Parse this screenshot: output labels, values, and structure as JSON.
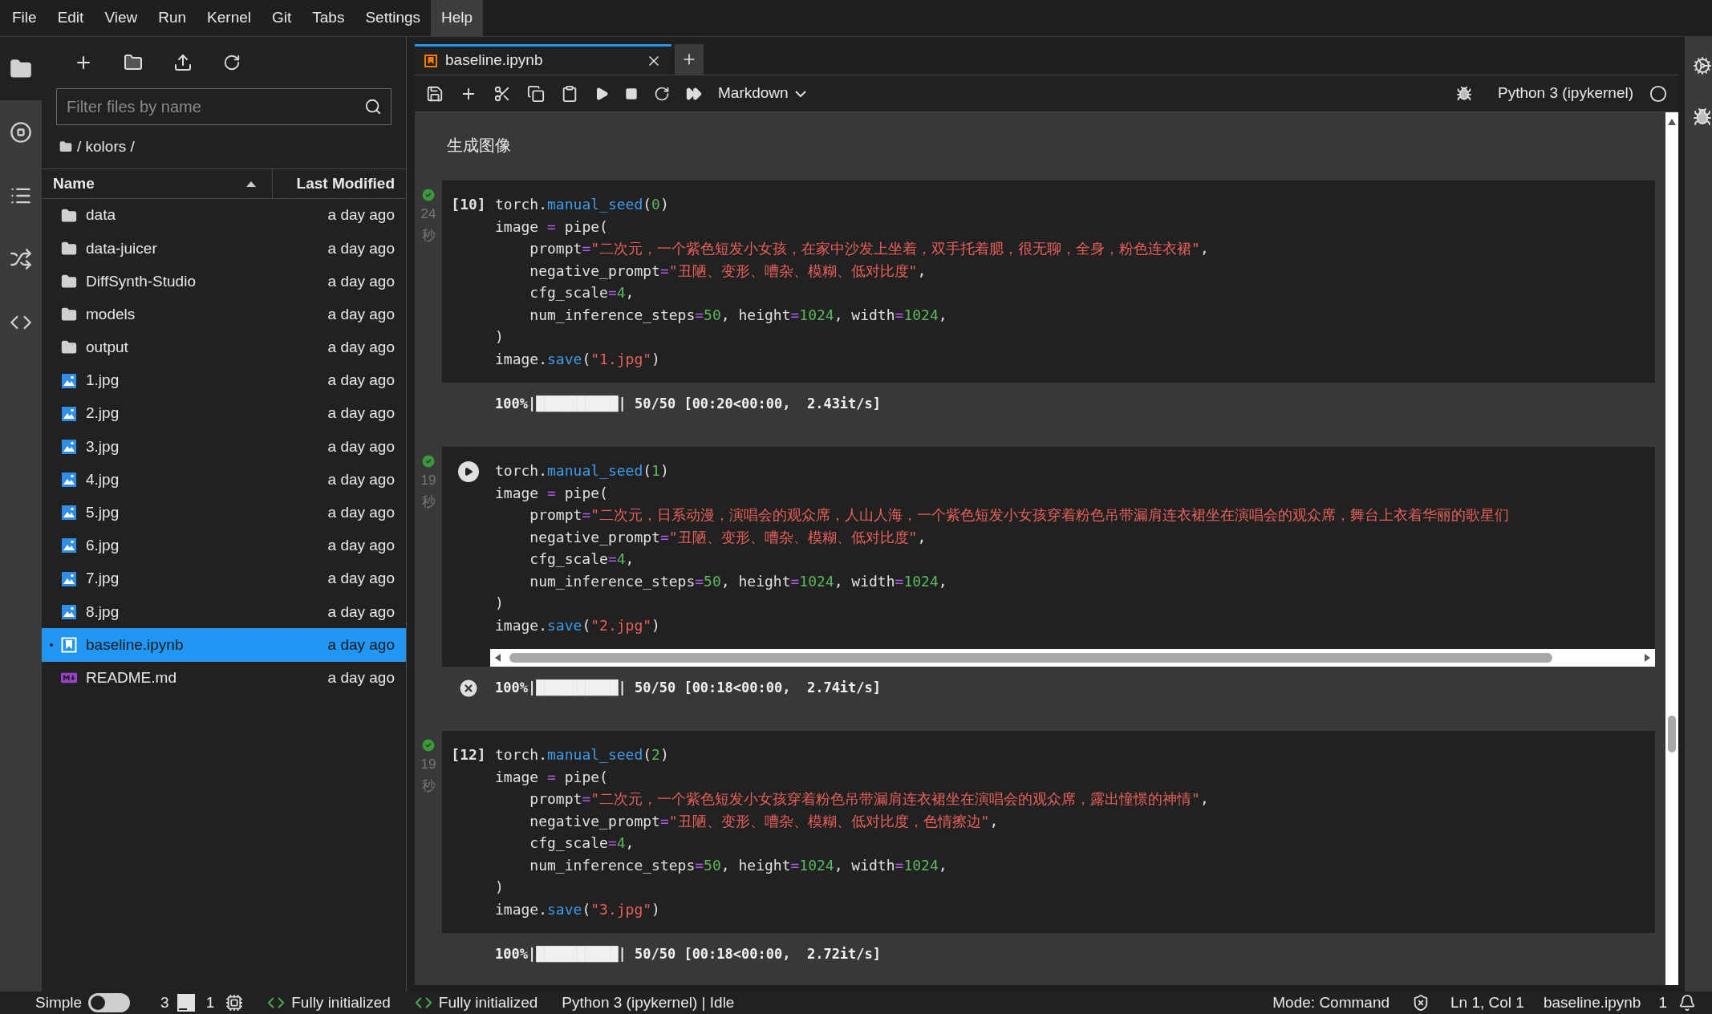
{
  "menu": [
    {
      "label": "File",
      "selected": false
    },
    {
      "label": "Edit",
      "selected": false
    },
    {
      "label": "View",
      "selected": false
    },
    {
      "label": "Run",
      "selected": false
    },
    {
      "label": "Kernel",
      "selected": false
    },
    {
      "label": "Git",
      "selected": false
    },
    {
      "label": "Tabs",
      "selected": false
    },
    {
      "label": "Settings",
      "selected": false
    },
    {
      "label": "Help",
      "selected": true
    }
  ],
  "activity_bar": [
    {
      "kind": "files",
      "selected": true
    },
    {
      "kind": "running",
      "selected": false
    },
    {
      "kind": "toc",
      "selected": false
    },
    {
      "kind": "git",
      "selected": false
    },
    {
      "kind": "code",
      "selected": false
    }
  ],
  "file_browser": {
    "filter": {
      "placeholder": "Filter files by name"
    },
    "path": "/ kolors /",
    "columns": [
      "Name",
      "Last Modified"
    ],
    "items": [
      {
        "name": "data",
        "modified": "a day ago",
        "kind": "folder",
        "selected": false
      },
      {
        "name": "data-juicer",
        "modified": "a day ago",
        "kind": "folder",
        "selected": false
      },
      {
        "name": "DiffSynth-Studio",
        "modified": "a day ago",
        "kind": "folder",
        "selected": false
      },
      {
        "name": "models",
        "modified": "a day ago",
        "kind": "folder",
        "selected": false
      },
      {
        "name": "output",
        "modified": "a day ago",
        "kind": "folder",
        "selected": false
      },
      {
        "name": "1.jpg",
        "modified": "a day ago",
        "kind": "image",
        "selected": false
      },
      {
        "name": "2.jpg",
        "modified": "a day ago",
        "kind": "image",
        "selected": false
      },
      {
        "name": "3.jpg",
        "modified": "a day ago",
        "kind": "image",
        "selected": false
      },
      {
        "name": "4.jpg",
        "modified": "a day ago",
        "kind": "image",
        "selected": false
      },
      {
        "name": "5.jpg",
        "modified": "a day ago",
        "kind": "image",
        "selected": false
      },
      {
        "name": "6.jpg",
        "modified": "a day ago",
        "kind": "image",
        "selected": false
      },
      {
        "name": "7.jpg",
        "modified": "a day ago",
        "kind": "image",
        "selected": false
      },
      {
        "name": "8.jpg",
        "modified": "a day ago",
        "kind": "image",
        "selected": false
      },
      {
        "name": "baseline.ipynb",
        "modified": "a day ago",
        "kind": "notebook",
        "selected": true
      },
      {
        "name": "README.md",
        "modified": "a day ago",
        "kind": "markdown",
        "selected": false
      }
    ]
  },
  "tab": {
    "title": "baseline.ipynb"
  },
  "toolbar": {
    "cell_type": "Markdown",
    "kernel": "Python 3 (ipykernel)"
  },
  "markdown_cell": {
    "text": "生成图像"
  },
  "cells": [
    {
      "prompt": "[10]",
      "succeeded": true,
      "time_value": "24",
      "time_unit": "秒",
      "h_scrollbar": false,
      "lines": [
        [
          {
            "kind": "plain",
            "text": "torch."
          },
          {
            "kind": "func",
            "text": "manual_seed"
          },
          {
            "kind": "plain",
            "text": "("
          },
          {
            "kind": "num",
            "text": "0"
          },
          {
            "kind": "plain",
            "text": ")"
          }
        ],
        [
          {
            "kind": "plain",
            "text": "image "
          },
          {
            "kind": "op",
            "text": "="
          },
          {
            "kind": "plain",
            "text": " pipe("
          }
        ],
        [
          {
            "kind": "plain",
            "text": "    prompt"
          },
          {
            "kind": "op",
            "text": "="
          },
          {
            "kind": "str",
            "text": "\"二次元，一个紫色短发小女孩，在家中沙发上坐着，双手托着腮，很无聊，全身，粉色连衣裙\""
          },
          {
            "kind": "plain",
            "text": ","
          }
        ],
        [
          {
            "kind": "plain",
            "text": "    negative_prompt"
          },
          {
            "kind": "op",
            "text": "="
          },
          {
            "kind": "str",
            "text": "\"丑陋、变形、嘈杂、模糊、低对比度\""
          },
          {
            "kind": "plain",
            "text": ","
          }
        ],
        [
          {
            "kind": "plain",
            "text": "    cfg_scale"
          },
          {
            "kind": "op",
            "text": "="
          },
          {
            "kind": "num",
            "text": "4"
          },
          {
            "kind": "plain",
            "text": ","
          }
        ],
        [
          {
            "kind": "plain",
            "text": "    num_inference_steps"
          },
          {
            "kind": "op",
            "text": "="
          },
          {
            "kind": "num",
            "text": "50"
          },
          {
            "kind": "plain",
            "text": ", height"
          },
          {
            "kind": "op",
            "text": "="
          },
          {
            "kind": "num",
            "text": "1024"
          },
          {
            "kind": "plain",
            "text": ", width"
          },
          {
            "kind": "op",
            "text": "="
          },
          {
            "kind": "num",
            "text": "1024"
          },
          {
            "kind": "plain",
            "text": ","
          }
        ],
        [
          {
            "kind": "plain",
            "text": ")"
          }
        ],
        [
          {
            "kind": "plain",
            "text": "image."
          },
          {
            "kind": "func",
            "text": "save"
          },
          {
            "kind": "plain",
            "text": "("
          },
          {
            "kind": "str",
            "text": "\"1.jpg\""
          },
          {
            "kind": "plain",
            "text": ")"
          }
        ]
      ],
      "output": {
        "text": "100%|██████████| 50/50 [00:20<00:00,  2.43it/s]",
        "clear_icon": false
      }
    },
    {
      "succeeded": true,
      "time_value": "19",
      "time_unit": "秒",
      "h_scrollbar": true,
      "lines": [
        [
          {
            "kind": "plain",
            "text": "torch."
          },
          {
            "kind": "func",
            "text": "manual_seed"
          },
          {
            "kind": "plain",
            "text": "("
          },
          {
            "kind": "num",
            "text": "1"
          },
          {
            "kind": "plain",
            "text": ")"
          }
        ],
        [
          {
            "kind": "plain",
            "text": "image "
          },
          {
            "kind": "op",
            "text": "="
          },
          {
            "kind": "plain",
            "text": " pipe("
          }
        ],
        [
          {
            "kind": "plain",
            "text": "    prompt"
          },
          {
            "kind": "op",
            "text": "="
          },
          {
            "kind": "str",
            "text": "\"二次元，日系动漫，演唱会的观众席，人山人海，一个紫色短发小女孩穿着粉色吊带漏肩连衣裙坐在演唱会的观众席，舞台上衣着华丽的歌星们"
          }
        ],
        [
          {
            "kind": "plain",
            "text": "    negative_prompt"
          },
          {
            "kind": "op",
            "text": "="
          },
          {
            "kind": "str",
            "text": "\"丑陋、变形、嘈杂、模糊、低对比度\""
          },
          {
            "kind": "plain",
            "text": ","
          }
        ],
        [
          {
            "kind": "plain",
            "text": "    cfg_scale"
          },
          {
            "kind": "op",
            "text": "="
          },
          {
            "kind": "num",
            "text": "4"
          },
          {
            "kind": "plain",
            "text": ","
          }
        ],
        [
          {
            "kind": "plain",
            "text": "    num_inference_steps"
          },
          {
            "kind": "op",
            "text": "="
          },
          {
            "kind": "num",
            "text": "50"
          },
          {
            "kind": "plain",
            "text": ", height"
          },
          {
            "kind": "op",
            "text": "="
          },
          {
            "kind": "num",
            "text": "1024"
          },
          {
            "kind": "plain",
            "text": ", width"
          },
          {
            "kind": "op",
            "text": "="
          },
          {
            "kind": "num",
            "text": "1024"
          },
          {
            "kind": "plain",
            "text": ","
          }
        ],
        [
          {
            "kind": "plain",
            "text": ")"
          }
        ],
        [
          {
            "kind": "plain",
            "text": "image."
          },
          {
            "kind": "func",
            "text": "save"
          },
          {
            "kind": "plain",
            "text": "("
          },
          {
            "kind": "str",
            "text": "\"2.jpg\""
          },
          {
            "kind": "plain",
            "text": ")"
          }
        ]
      ],
      "output": {
        "text": "100%|██████████| 50/50 [00:18<00:00,  2.74it/s]",
        "clear_icon": true
      }
    },
    {
      "prompt": "[12]",
      "succeeded": true,
      "time_value": "19",
      "time_unit": "秒",
      "h_scrollbar": false,
      "lines": [
        [
          {
            "kind": "plain",
            "text": "torch."
          },
          {
            "kind": "func",
            "text": "manual_seed"
          },
          {
            "kind": "plain",
            "text": "("
          },
          {
            "kind": "num",
            "text": "2"
          },
          {
            "kind": "plain",
            "text": ")"
          }
        ],
        [
          {
            "kind": "plain",
            "text": "image "
          },
          {
            "kind": "op",
            "text": "="
          },
          {
            "kind": "plain",
            "text": " pipe("
          }
        ],
        [
          {
            "kind": "plain",
            "text": "    prompt"
          },
          {
            "kind": "op",
            "text": "="
          },
          {
            "kind": "str",
            "text": "\"二次元，一个紫色短发小女孩穿着粉色吊带漏肩连衣裙坐在演唱会的观众席，露出憧憬的神情\""
          },
          {
            "kind": "plain",
            "text": ","
          }
        ],
        [
          {
            "kind": "plain",
            "text": "    negative_prompt"
          },
          {
            "kind": "op",
            "text": "="
          },
          {
            "kind": "str",
            "text": "\"丑陋、变形、嘈杂、模糊、低对比度，色情擦边\""
          },
          {
            "kind": "plain",
            "text": ","
          }
        ],
        [
          {
            "kind": "plain",
            "text": "    cfg_scale"
          },
          {
            "kind": "op",
            "text": "="
          },
          {
            "kind": "num",
            "text": "4"
          },
          {
            "kind": "plain",
            "text": ","
          }
        ],
        [
          {
            "kind": "plain",
            "text": "    num_inference_steps"
          },
          {
            "kind": "op",
            "text": "="
          },
          {
            "kind": "num",
            "text": "50"
          },
          {
            "kind": "plain",
            "text": ", height"
          },
          {
            "kind": "op",
            "text": "="
          },
          {
            "kind": "num",
            "text": "1024"
          },
          {
            "kind": "plain",
            "text": ", width"
          },
          {
            "kind": "op",
            "text": "="
          },
          {
            "kind": "num",
            "text": "1024"
          },
          {
            "kind": "plain",
            "text": ","
          }
        ],
        [
          {
            "kind": "plain",
            "text": ")"
          }
        ],
        [
          {
            "kind": "plain",
            "text": "image."
          },
          {
            "kind": "func",
            "text": "save"
          },
          {
            "kind": "plain",
            "text": "("
          },
          {
            "kind": "str",
            "text": "\"3.jpg\""
          },
          {
            "kind": "plain",
            "text": ")"
          }
        ]
      ],
      "output": {
        "text": "100%|██████████| 50/50 [00:18<00:00,  2.72it/s]",
        "clear_icon": false
      }
    }
  ],
  "status_bar": {
    "simple": {
      "label": "Simple",
      "on": false
    },
    "terminals": "3",
    "kernels": "1",
    "lsp": [
      "Fully initialized",
      "Fully initialized"
    ],
    "kernel_status": "Python 3 (ipykernel) | Idle",
    "mode": "Mode: Command",
    "cursor": "Ln 1, Col 1",
    "file": "baseline.ipynb",
    "notifications": "1"
  }
}
